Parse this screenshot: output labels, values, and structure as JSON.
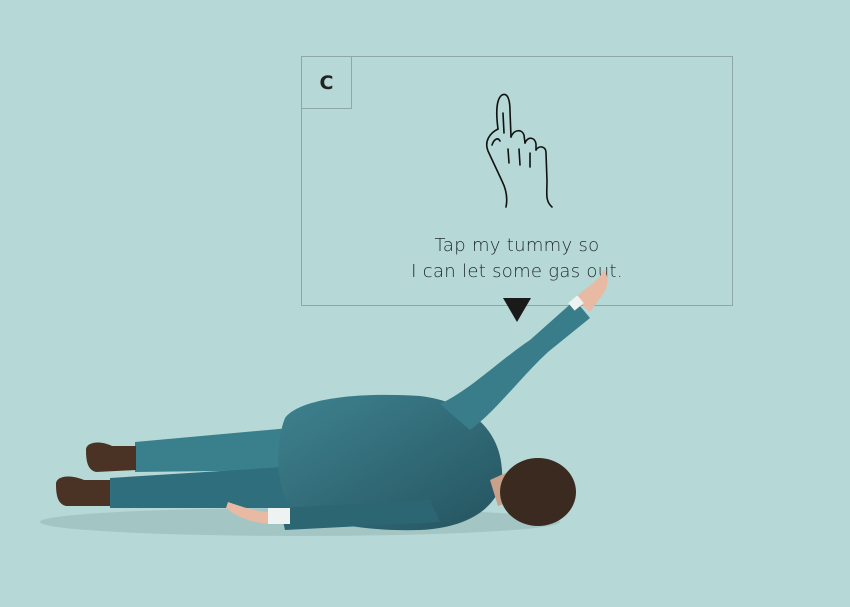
{
  "instruction": {
    "close_label": "C",
    "line1": "Tap my tummy so",
    "line2": "I can let some gas out."
  },
  "icons": {
    "hand": "tap-finger-icon",
    "pointer": "down-triangle-icon"
  },
  "colors": {
    "background": "#b6d8d6",
    "suit": "#3e7f8c",
    "frame": "#8fa8a6"
  }
}
